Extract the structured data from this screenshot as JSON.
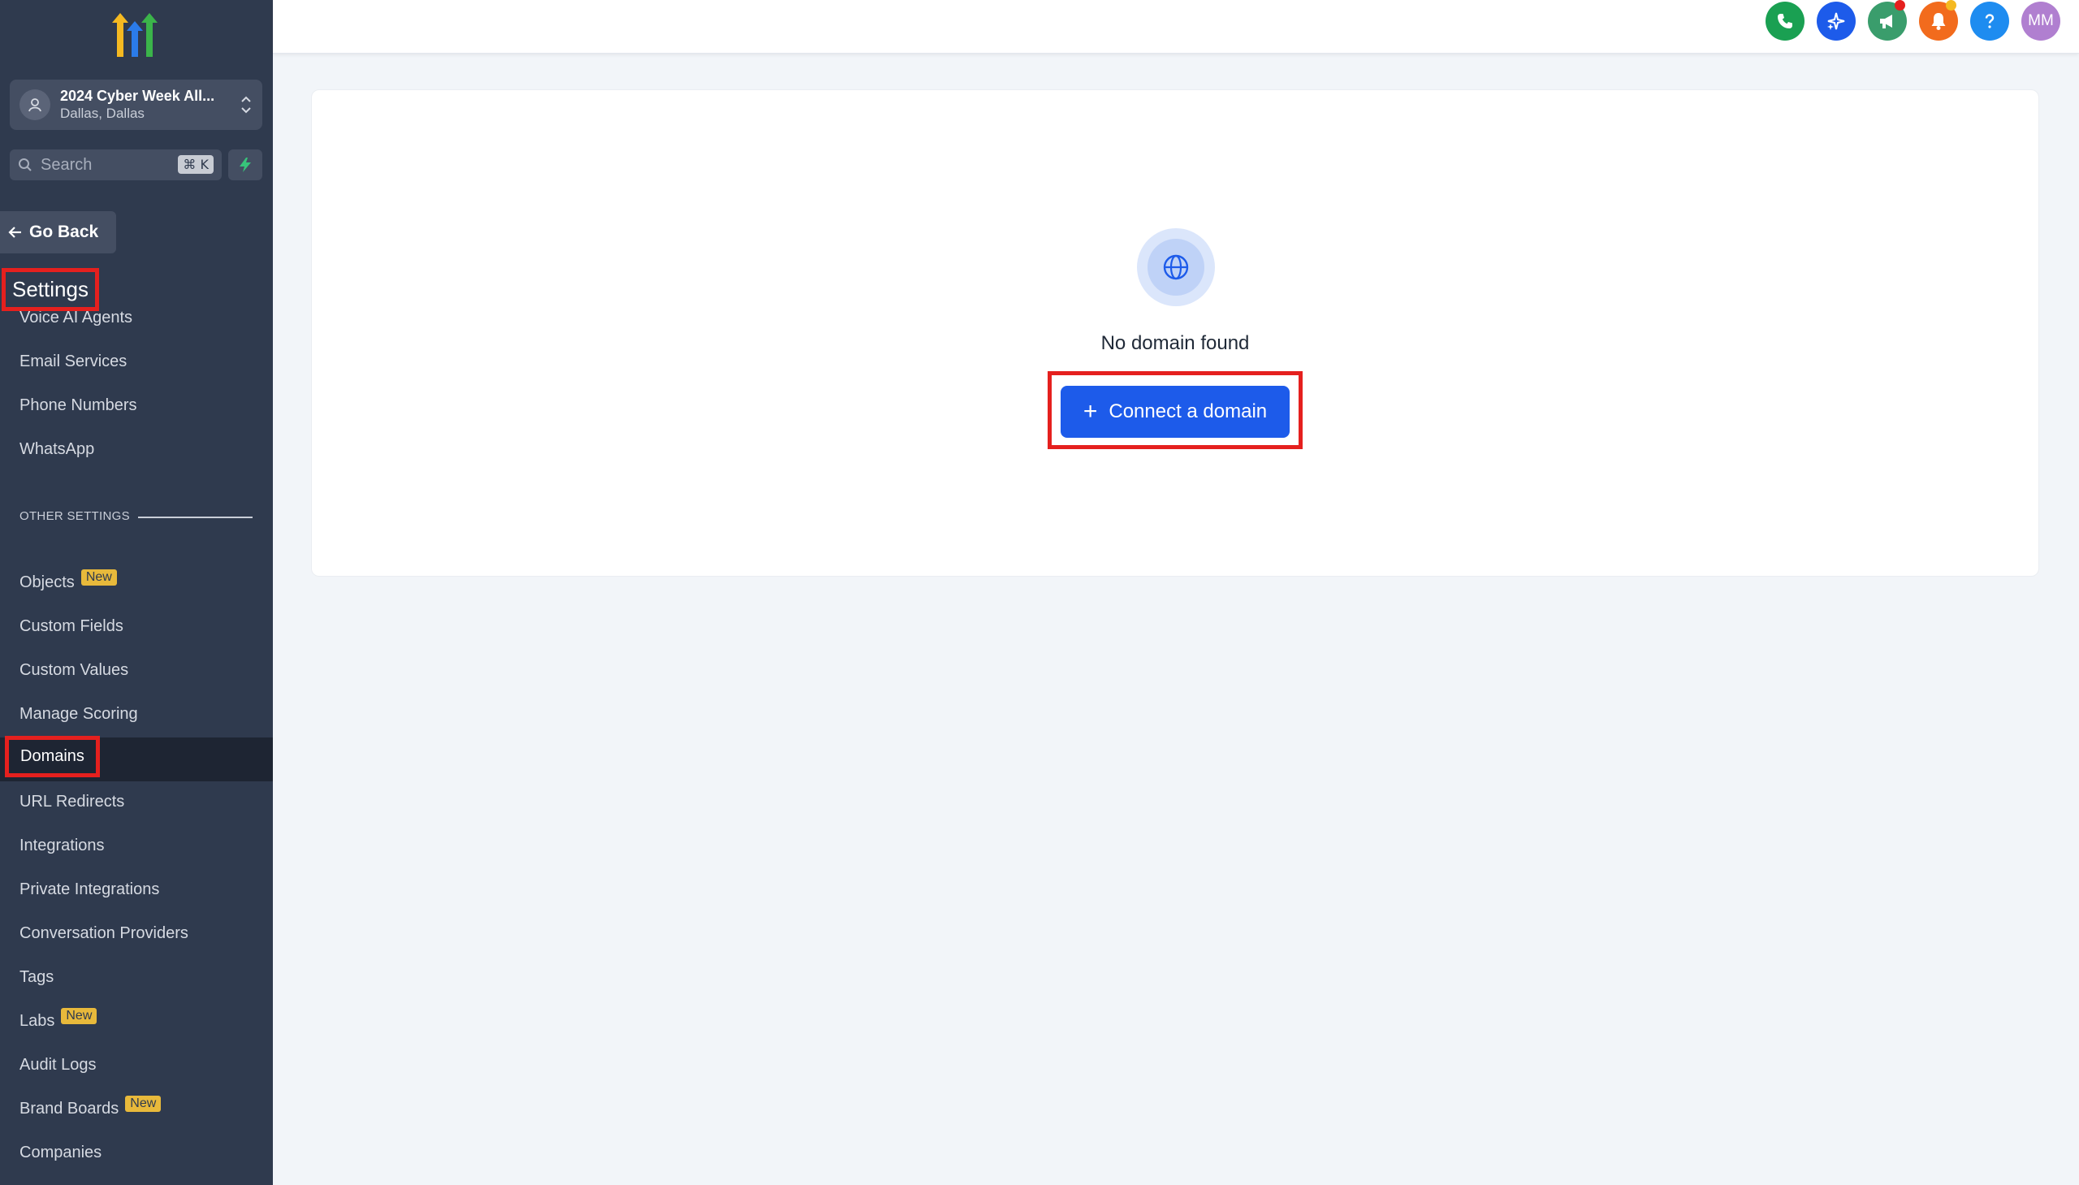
{
  "sidebar": {
    "account": {
      "name": "2024 Cyber Week All...",
      "location": "Dallas, Dallas"
    },
    "search": {
      "placeholder": "Search",
      "shortcut": "⌘ K"
    },
    "go_back": "Go Back",
    "heading": "Settings",
    "partial_item": "Voice AI Agents",
    "items_top": [
      "Email Services",
      "Phone Numbers",
      "WhatsApp"
    ],
    "section_label": "OTHER SETTINGS",
    "items": [
      {
        "label": "Objects",
        "badge": "New"
      },
      {
        "label": "Custom Fields"
      },
      {
        "label": "Custom Values"
      },
      {
        "label": "Manage Scoring"
      },
      {
        "label": "Domains",
        "active": true
      },
      {
        "label": "URL Redirects"
      },
      {
        "label": "Integrations"
      },
      {
        "label": "Private Integrations"
      },
      {
        "label": "Conversation Providers"
      },
      {
        "label": "Tags"
      },
      {
        "label": "Labs",
        "badge": "New"
      },
      {
        "label": "Audit Logs"
      },
      {
        "label": "Brand Boards",
        "badge": "New"
      },
      {
        "label": "Companies"
      }
    ]
  },
  "topbar": {
    "icons": [
      {
        "name": "phone-icon",
        "color": "#1aa052"
      },
      {
        "name": "ai-sparkle-icon",
        "color": "#1d5bea"
      },
      {
        "name": "megaphone-icon",
        "color": "#3a9d6c"
      },
      {
        "name": "bell-icon",
        "color": "#f26b1d"
      },
      {
        "name": "help-icon",
        "color": "#1e8cf0"
      }
    ],
    "avatar_initials": "MM",
    "avatar_color": "#b07fd0"
  },
  "main": {
    "empty_title": "No domain found",
    "connect_button": "Connect a domain"
  },
  "colors": {
    "sidebar_bg": "#2f3a4e",
    "primary": "#1d5bea",
    "highlight_outline": "#e5201e",
    "new_badge": "#e8b93b"
  }
}
